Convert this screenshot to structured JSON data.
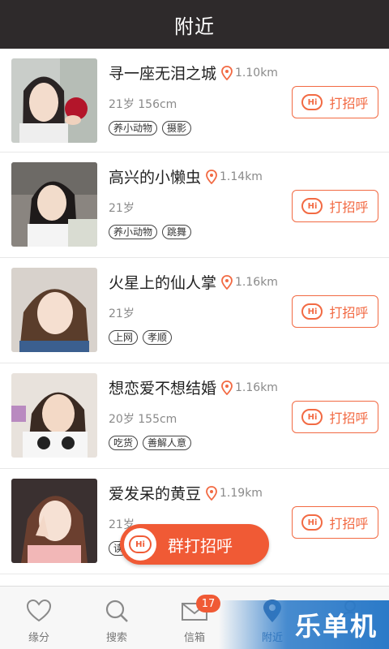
{
  "header": {
    "title": "附近"
  },
  "users": [
    {
      "name": "寻一座无泪之城",
      "distance": "1.10km",
      "meta": "21岁 156cm",
      "tags": [
        "养小动物",
        "摄影"
      ],
      "greet": "打招呼",
      "hi": "Hi"
    },
    {
      "name": "高兴的小懒虫",
      "distance": "1.14km",
      "meta": "21岁",
      "tags": [
        "养小动物",
        "跳舞"
      ],
      "greet": "打招呼",
      "hi": "Hi"
    },
    {
      "name": "火星上的仙人掌",
      "distance": "1.16km",
      "meta": "21岁",
      "tags": [
        "上网",
        "孝顺"
      ],
      "greet": "打招呼",
      "hi": "Hi"
    },
    {
      "name": "想恋爱不想结婚",
      "distance": "1.16km",
      "meta": "20岁 155cm",
      "tags": [
        "吃货",
        "善解人意"
      ],
      "greet": "打招呼",
      "hi": "Hi"
    },
    {
      "name": "爱发呆的黄豆",
      "distance": "1.19km",
      "meta": "21岁",
      "tags": [
        "读"
      ],
      "greet": "打招呼",
      "hi": "Hi"
    }
  ],
  "group_greet": {
    "label": "群打招呼",
    "hi": "Hi"
  },
  "tabbar": {
    "items": [
      {
        "label": "缘分",
        "icon": "heart-icon"
      },
      {
        "label": "搜索",
        "icon": "search-icon"
      },
      {
        "label": "信箱",
        "icon": "mail-icon",
        "badge": "17"
      },
      {
        "label": "附近",
        "icon": "location-pin-icon",
        "active": true
      },
      {
        "label": "",
        "icon": "profile-icon"
      }
    ]
  },
  "watermark": "乐单机",
  "colors": {
    "accent": "#f05a35",
    "header_bg": "#2e2a2b",
    "active_tab": "#3f6fa8"
  }
}
